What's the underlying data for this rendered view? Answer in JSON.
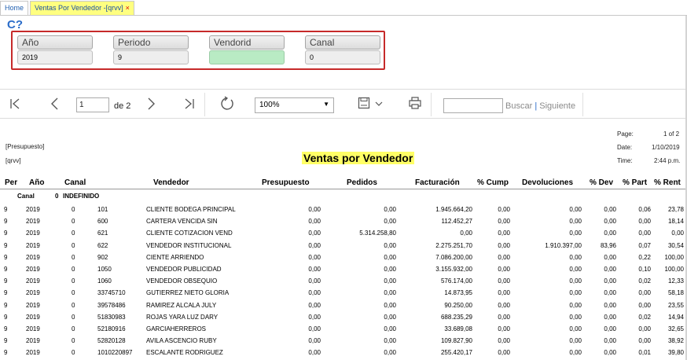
{
  "tabs": {
    "home": "Home",
    "active": "Ventas Por Vendedor -[qrvv]",
    "close": "×"
  },
  "help_icon": "C?",
  "params": [
    {
      "label": "Año",
      "value": "2019"
    },
    {
      "label": "Periodo",
      "value": "9"
    },
    {
      "label": "Vendorid",
      "value": ""
    },
    {
      "label": "Canal",
      "value": "0"
    }
  ],
  "toolbar": {
    "page_value": "1",
    "page_of": "de 2",
    "zoom": "100%",
    "find_label": "Buscar",
    "separator": "|",
    "next_label": "Siguiente",
    "icons": [
      "first-page-icon",
      "prev-page-icon",
      "next-page-icon",
      "last-page-icon",
      "refresh-icon",
      "save-icon",
      "print-icon"
    ]
  },
  "report": {
    "presupuesto": "[Presupuesto]",
    "code": "[qrvv]",
    "title": "Ventas por Vendedor",
    "page_label": "Page:",
    "page_value": "1 of 2",
    "date_label": "Date:",
    "date_value": "1/10/2019",
    "time_label": "Time:",
    "time_value": "2:44 p.m."
  },
  "columns": [
    "Per",
    "Año",
    "Canal",
    "Vendedor",
    "Presupuesto",
    "Pedidos",
    "Facturación",
    "% Cump",
    "Devoluciones",
    "% Dev",
    "% Part",
    "% Rent"
  ],
  "group": {
    "label": "Canal",
    "value": "0",
    "name": "INDEFINIDO"
  },
  "rows": [
    [
      "9",
      "2019",
      "0",
      "101",
      "CLIENTE  BODEGA PRINCIPAL",
      "0,00",
      "0,00",
      "1.945.664,20",
      "0,00",
      "0,00",
      "0,00",
      "0,06",
      "23,78"
    ],
    [
      "9",
      "2019",
      "0",
      "600",
      "CARTERA VENCIDA SIN",
      "0,00",
      "0,00",
      "112.452,27",
      "0,00",
      "0,00",
      "0,00",
      "0,00",
      "18,14"
    ],
    [
      "9",
      "2019",
      "0",
      "621",
      "CLIENTE  COTIZACION VEND",
      "0,00",
      "5.314.258,80",
      "0,00",
      "0,00",
      "0,00",
      "0,00",
      "0,00",
      "0,00"
    ],
    [
      "9",
      "2019",
      "0",
      "622",
      "VENDEDOR  INSTITUCIONAL",
      "0,00",
      "0,00",
      "2.275.251,70",
      "0,00",
      "1.910.397,00",
      "83,96",
      "0,07",
      "30,54"
    ],
    [
      "9",
      "2019",
      "0",
      "902",
      "CIENTE  ARRIENDO",
      "0,00",
      "0,00",
      "7.086.200,00",
      "0,00",
      "0,00",
      "0,00",
      "0,22",
      "100,00"
    ],
    [
      "9",
      "2019",
      "0",
      "1050",
      "VENDEDOR  PUBLICIDAD",
      "0,00",
      "0,00",
      "3.155.932,00",
      "0,00",
      "0,00",
      "0,00",
      "0,10",
      "100,00"
    ],
    [
      "9",
      "2019",
      "0",
      "1060",
      "VENDEDOR  OBSEQUIO",
      "0,00",
      "0,00",
      "576.174,00",
      "0,00",
      "0,00",
      "0,00",
      "0,02",
      "12,33"
    ],
    [
      "9",
      "2019",
      "0",
      "33745710",
      "GUTIERREZ NIETO GLORIA",
      "0,00",
      "0,00",
      "14.873,95",
      "0,00",
      "0,00",
      "0,00",
      "0,00",
      "58,18"
    ],
    [
      "9",
      "2019",
      "0",
      "39578486",
      "RAMIREZ ALCALA JULY",
      "0,00",
      "0,00",
      "90.250,00",
      "0,00",
      "0,00",
      "0,00",
      "0,00",
      "23,55"
    ],
    [
      "9",
      "2019",
      "0",
      "51830983",
      "ROJAS YARA LUZ DARY",
      "0,00",
      "0,00",
      "688.235,29",
      "0,00",
      "0,00",
      "0,00",
      "0,02",
      "14,94"
    ],
    [
      "9",
      "2019",
      "0",
      "52180916",
      "GARCIAHERREROS",
      "0,00",
      "0,00",
      "33.689,08",
      "0,00",
      "0,00",
      "0,00",
      "0,00",
      "32,65"
    ],
    [
      "9",
      "2019",
      "0",
      "52820128",
      "AVILA ASCENCIO RUBY",
      "0,00",
      "0,00",
      "109.827,90",
      "0,00",
      "0,00",
      "0,00",
      "0,00",
      "38,92"
    ],
    [
      "9",
      "2019",
      "0",
      "1010220897",
      "ESCALANTE RODRIGUEZ",
      "0,00",
      "0,00",
      "255.420,17",
      "0,00",
      "0,00",
      "0,00",
      "0,01",
      "39,80"
    ]
  ]
}
